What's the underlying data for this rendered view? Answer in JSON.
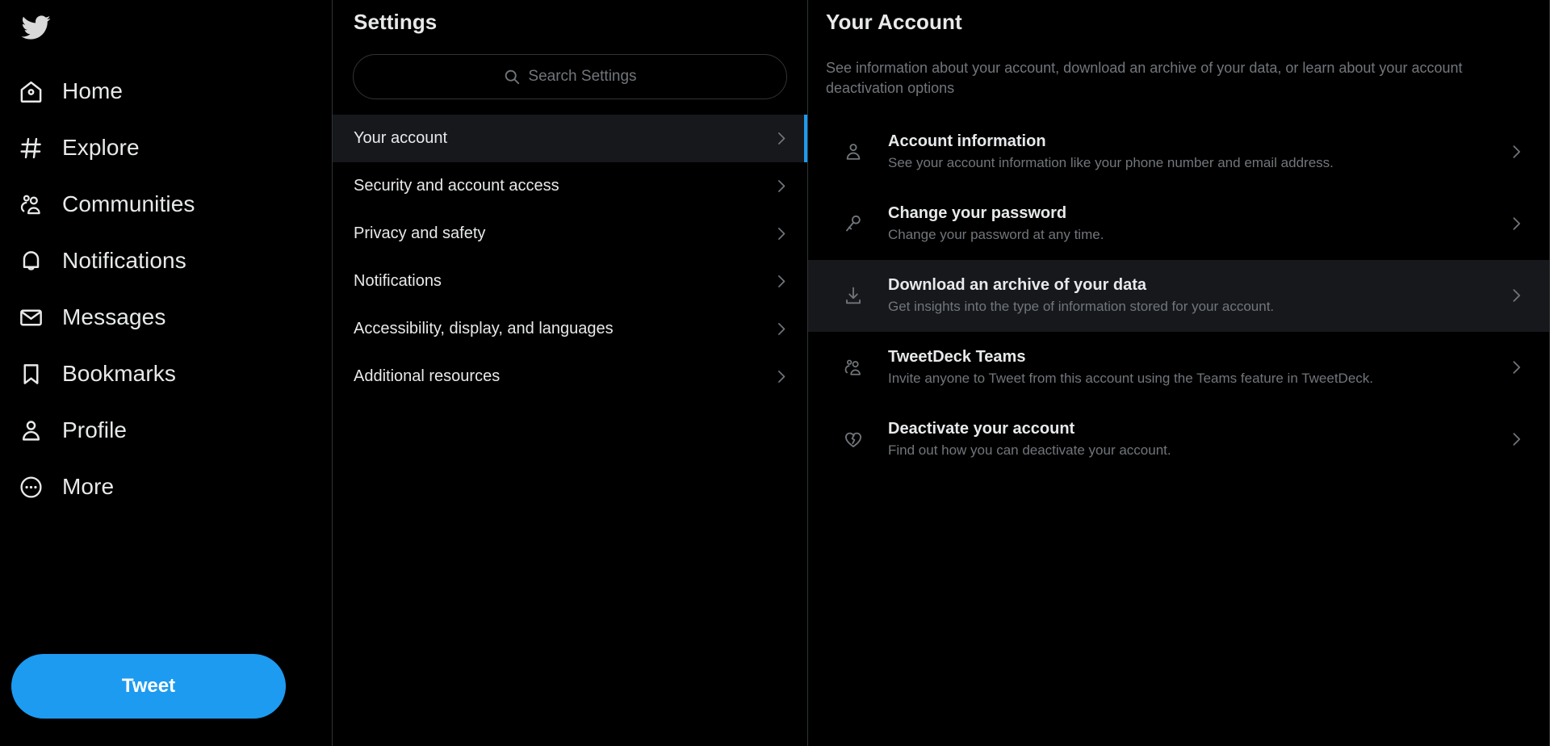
{
  "brand": {
    "logo_icon": "twitter-bird-icon",
    "accent_color": "#1d9bf0",
    "text_color": "#e7e9ea",
    "muted_color": "#71767b",
    "selected_bg": "#16181c",
    "border_color": "#2f3336"
  },
  "sidebar": {
    "items": [
      {
        "label": "Home",
        "icon": "home-icon"
      },
      {
        "label": "Explore",
        "icon": "hashtag-icon"
      },
      {
        "label": "Communities",
        "icon": "communities-icon"
      },
      {
        "label": "Notifications",
        "icon": "bell-icon"
      },
      {
        "label": "Messages",
        "icon": "envelope-icon"
      },
      {
        "label": "Bookmarks",
        "icon": "bookmark-icon"
      },
      {
        "label": "Profile",
        "icon": "person-icon"
      },
      {
        "label": "More",
        "icon": "more-circle-icon"
      }
    ],
    "tweet_button": "Tweet"
  },
  "settings": {
    "title": "Settings",
    "search": {
      "placeholder": "Search Settings",
      "value": "",
      "icon": "search-icon"
    },
    "items": [
      {
        "label": "Your account",
        "selected": true
      },
      {
        "label": "Security and account access",
        "selected": false
      },
      {
        "label": "Privacy and safety",
        "selected": false
      },
      {
        "label": "Notifications",
        "selected": false
      },
      {
        "label": "Accessibility, display, and languages",
        "selected": false
      },
      {
        "label": "Additional resources",
        "selected": false
      }
    ]
  },
  "detail": {
    "title": "Your Account",
    "description": "See information about your account, download an archive of your data, or learn about your account deactivation options",
    "rows": [
      {
        "title": "Account information",
        "subtitle": "See your account information like your phone number and email address.",
        "icon": "person-icon",
        "active": false
      },
      {
        "title": "Change your password",
        "subtitle": "Change your password at any time.",
        "icon": "key-icon",
        "active": false
      },
      {
        "title": "Download an archive of your data",
        "subtitle": "Get insights into the type of information stored for your account.",
        "icon": "download-icon",
        "active": true
      },
      {
        "title": "TweetDeck Teams",
        "subtitle": "Invite anyone to Tweet from this account using the Teams feature in TweetDeck.",
        "icon": "communities-icon",
        "active": false
      },
      {
        "title": "Deactivate your account",
        "subtitle": "Find out how you can deactivate your account.",
        "icon": "broken-heart-icon",
        "active": false
      }
    ]
  }
}
